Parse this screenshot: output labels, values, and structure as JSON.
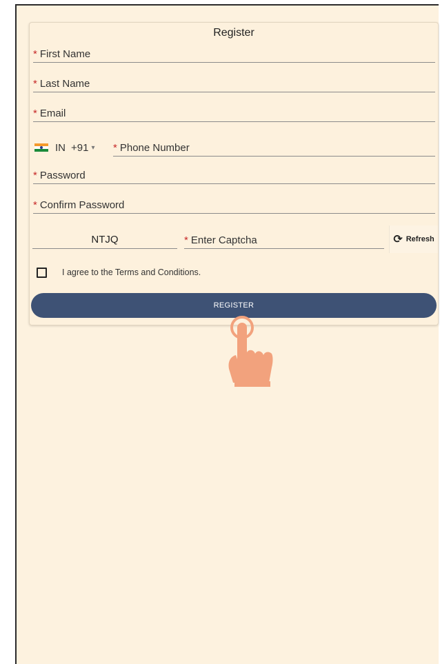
{
  "form": {
    "title": "Register",
    "required_mark": "*",
    "first_name_label": "First Name",
    "last_name_label": "Last Name",
    "email_label": "Email",
    "country_code": "IN",
    "dial_code": "+91",
    "country_caret": "▾",
    "phone_label": "Phone Number",
    "password_label": "Password",
    "confirm_password_label": "Confirm Password",
    "captcha_code": "NTJQ",
    "captcha_label": "Enter Captcha",
    "refresh_label": "Refresh",
    "refresh_icon": "⟳",
    "terms_label": "I agree to the Terms and Conditions.",
    "terms_checked": false,
    "register_label": "REGISTER"
  },
  "icons": {
    "flag": "india-flag-icon",
    "refresh": "refresh-icon",
    "pointer": "tap-hand-icon"
  },
  "colors": {
    "background": "#fdf2df",
    "required": "#c62828",
    "button": "#3e5275",
    "hand": "#f2a27d"
  }
}
